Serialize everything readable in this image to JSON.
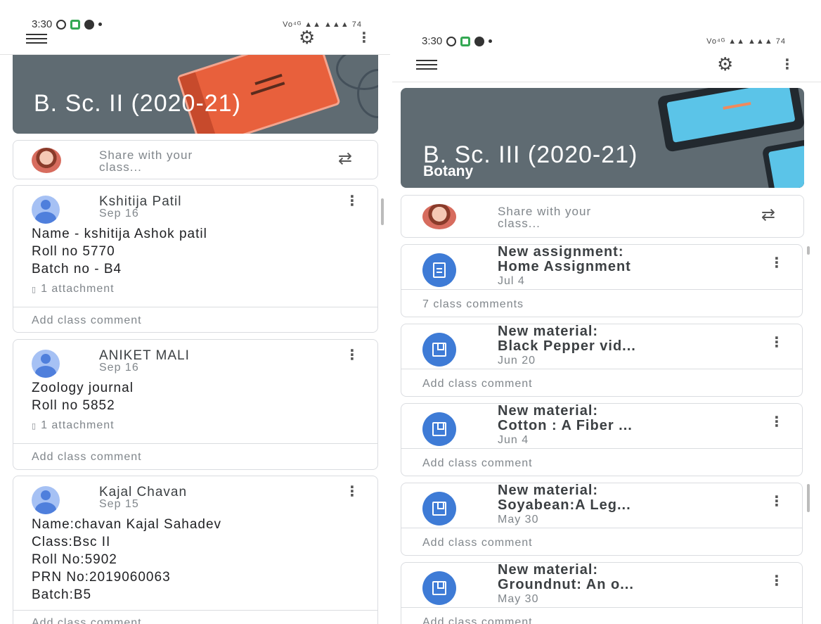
{
  "left": {
    "status": {
      "time": "3:30",
      "indicators": "Vo⁴ᴳ ▲▲ ▲▲▲ 74"
    },
    "class_title": "B. Sc. II (2020-21)",
    "share_placeholder": [
      "Share with your",
      "class..."
    ],
    "posts": [
      {
        "author": "Kshitija Patil",
        "date": "Sep 16",
        "lines": [
          "Name  - kshitija Ashok patil",
          "Roll no 5770",
          "Batch no - B4"
        ],
        "attachment": "1 attachment",
        "comment_label": "Add class comment"
      },
      {
        "author": "ANIKET MALI",
        "date": "Sep 16",
        "lines": [
          "Zoology journal",
          "Roll no 5852"
        ],
        "attachment": "1 attachment",
        "comment_label": "Add class comment"
      },
      {
        "author": "Kajal Chavan",
        "date": "Sep 15",
        "lines": [
          "Name:chavan Kajal Sahadev",
          "Class:Bsc II",
          "Roll No:5902",
          "PRN No:2019060063",
          "Batch:B5"
        ],
        "comment_label": "Add class comment"
      }
    ]
  },
  "right": {
    "status": {
      "time": "3:30",
      "indicators": "Vo⁴ᴳ ▲▲ ▲▲▲ 74"
    },
    "class_title": "B. Sc. III (2020-21)",
    "class_subject": "Botany",
    "share_placeholder": [
      "Share with your",
      "class..."
    ],
    "feed": [
      {
        "kind": "assignment",
        "title": [
          "New assignment:",
          "Home Assignment"
        ],
        "date": "Jul 4",
        "comment_label": "7 class comments"
      },
      {
        "kind": "material",
        "title": [
          "New material:",
          "Black Pepper vid..."
        ],
        "date": "Jun 20",
        "comment_label": "Add class comment"
      },
      {
        "kind": "material",
        "title": [
          "New material:",
          "Cotton : A Fiber ..."
        ],
        "date": "Jun 4",
        "comment_label": "Add class comment"
      },
      {
        "kind": "material",
        "title": [
          "New material:",
          "Soyabean:A Leg..."
        ],
        "date": "May 30",
        "comment_label": "Add class comment"
      },
      {
        "kind": "material",
        "title": [
          "New material:",
          "Groundnut: An o..."
        ],
        "date": "May 30",
        "comment_label": "Add class comment"
      }
    ]
  },
  "icons": {
    "menu": "hamburger-icon",
    "settings": "gear-icon",
    "overflow": "more-vert-icon",
    "repost": "repost-icon",
    "assignment": "assignment-icon",
    "material": "material-icon",
    "attachment": "paperclip-icon"
  },
  "colors": {
    "banner_left": "#5f6b72",
    "banner_right": "#5f6b72",
    "icon_blue": "#3e7bd6",
    "avatar_blue": "#a6c1f4",
    "book_orange": "#e8603c"
  }
}
